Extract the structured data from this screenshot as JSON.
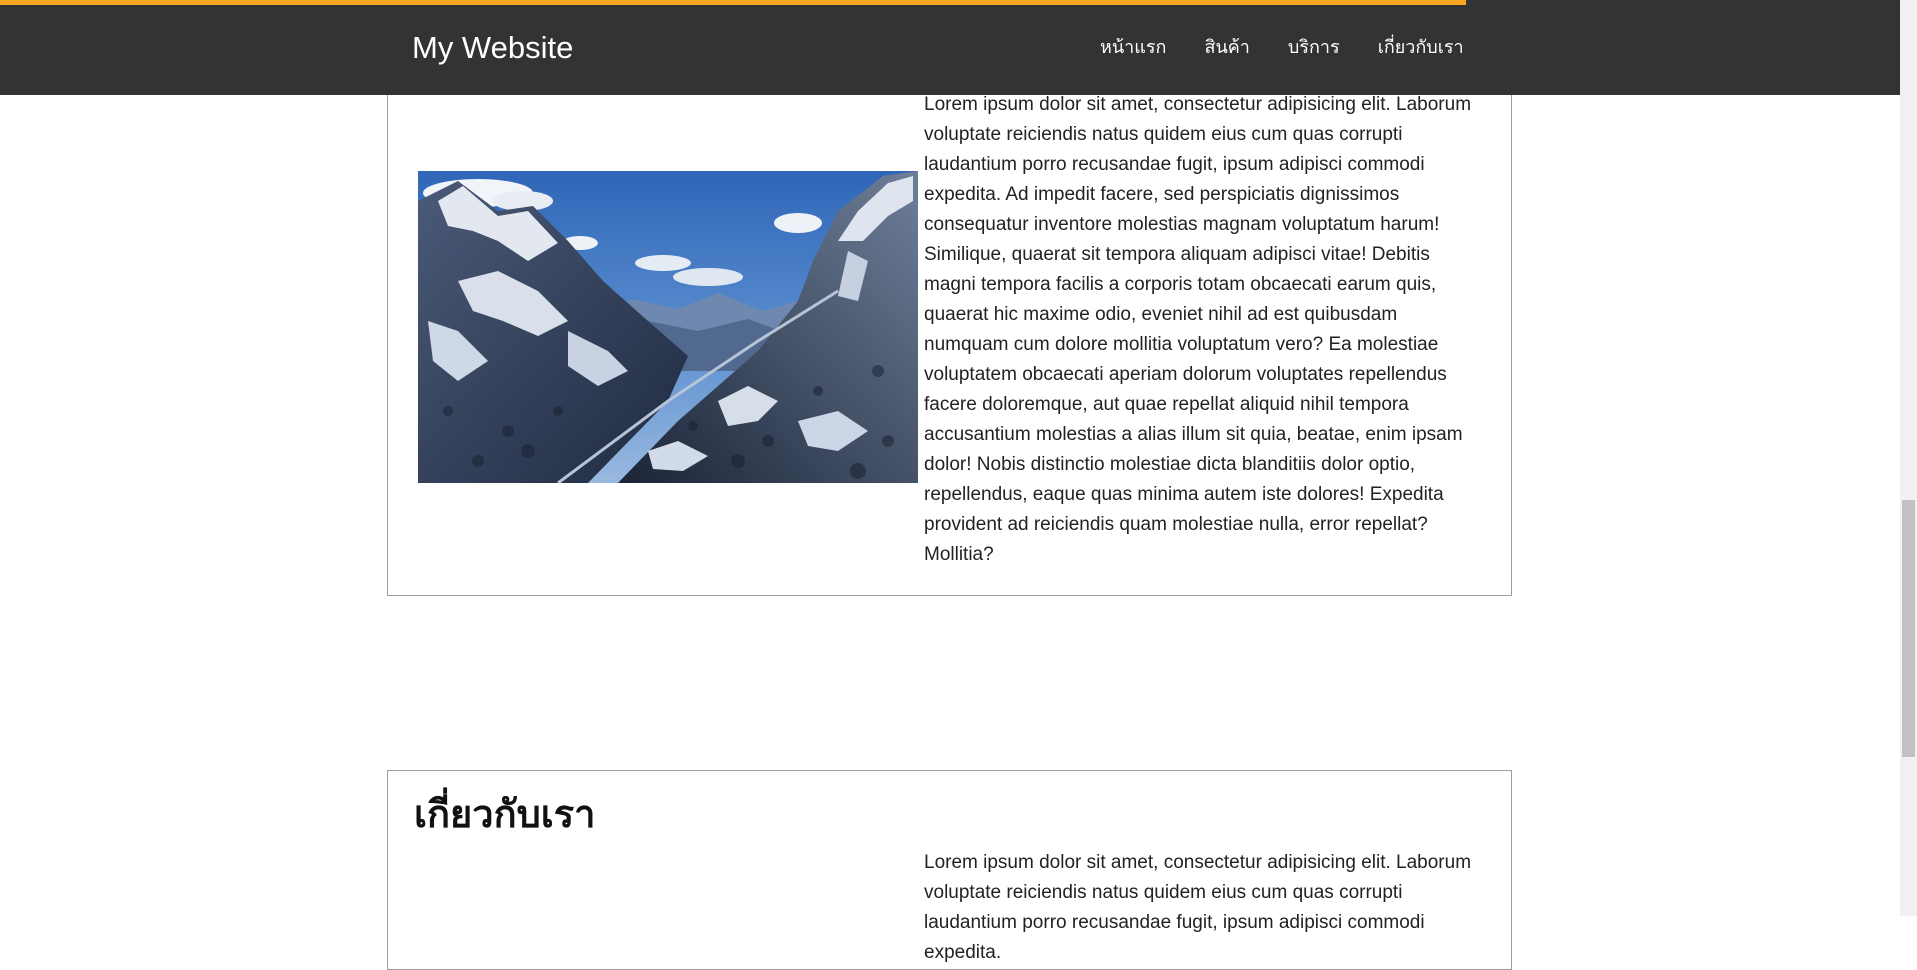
{
  "header": {
    "brand": "My Website",
    "nav": [
      "หน้าแรก",
      "สินค้า",
      "บริการ",
      "เกี่ยวกับเรา"
    ],
    "accent_color": "#f5a623",
    "background_color": "#333333"
  },
  "sections": {
    "first": {
      "image": "mountain-landscape-photo",
      "text": "Lorem ipsum dolor sit amet, consectetur adipisicing elit. Laborum voluptate reiciendis natus quidem eius cum quas corrupti laudantium porro recusandae fugit, ipsum adipisci commodi expedita. Ad impedit facere, sed perspiciatis dignissimos consequatur inventore molestias magnam voluptatum harum! Similique, quaerat sit tempora aliquam adipisci vitae! Debitis magni tempora facilis a corporis totam obcaecati earum quis, quaerat hic maxime odio, eveniet nihil ad est quibusdam numquam cum dolore mollitia voluptatum vero? Ea molestiae voluptatem obcaecati aperiam dolorum voluptates repellendus facere doloremque, aut quae repellat aliquid nihil tempora accusantium molestias a alias illum sit quia, beatae, enim ipsam dolor! Nobis distinctio molestiae dicta blanditiis dolor optio, repellendus, eaque quas minima autem iste dolores! Expedita provident ad reiciendis quam molestiae nulla, error repellat? Mollitia?"
    },
    "about": {
      "title": "เกี่ยวกับเรา",
      "text": "Lorem ipsum dolor sit amet, consectetur adipisicing elit. Laborum voluptate reiciendis natus quidem eius cum quas corrupti laudantium porro recusandae fugit, ipsum adipisci commodi expedita."
    }
  }
}
